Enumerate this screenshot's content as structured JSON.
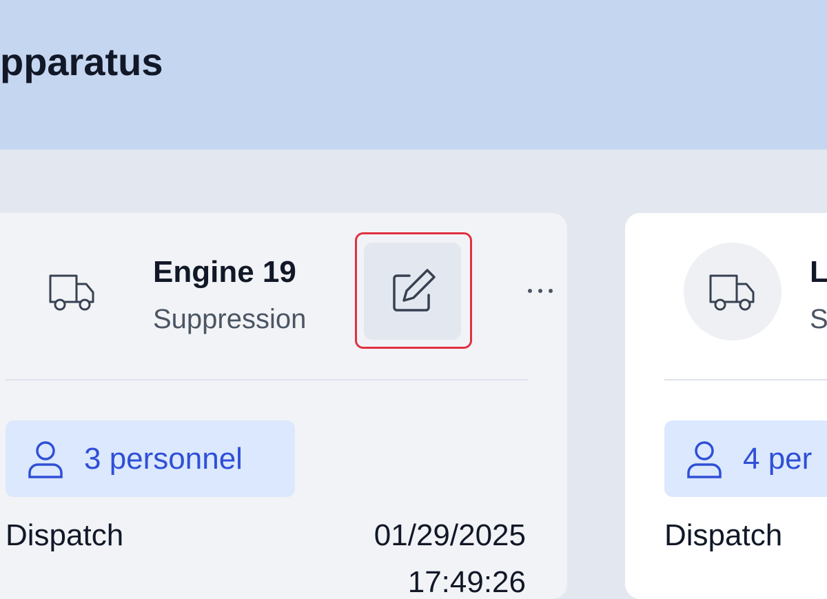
{
  "page": {
    "title": "pparatus"
  },
  "cards": [
    {
      "unit_name": "Engine 19",
      "unit_type": "Suppression",
      "icon": "truck-icon",
      "edit_icon": "edit-icon",
      "more_icon": "more-horizontal-icon",
      "personnel_label": "3 personnel",
      "dispatch_label": "Dispatch",
      "dispatch_date": "01/29/2025",
      "dispatch_time": "17:49:26"
    },
    {
      "unit_name": "L",
      "unit_type": "S",
      "icon": "truck-icon",
      "personnel_label": "4 per",
      "dispatch_label": "Dispatch"
    }
  ],
  "colors": {
    "header_bg": "#c5d6f0",
    "page_bg": "#e3e8f0",
    "personnel_bg": "#dbe8fd",
    "personnel_text": "#2f4fd6",
    "highlight": "#e0303f"
  }
}
